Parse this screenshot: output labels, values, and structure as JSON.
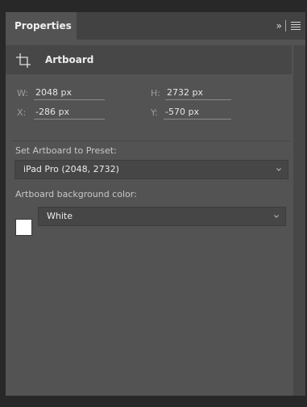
{
  "panel": {
    "tab_label": "Properties",
    "collapse_glyph": "»",
    "section_title": "Artboard"
  },
  "fields": {
    "w_label": "W:",
    "w_value": "2048 px",
    "h_label": "H:",
    "h_value": "2732 px",
    "x_label": "X:",
    "x_value": "-286 px",
    "y_label": "Y:",
    "y_value": "-570 px"
  },
  "preset": {
    "label": "Set Artboard to Preset:",
    "selected": "iPad Pro (2048, 2732)"
  },
  "background": {
    "label": "Artboard background color:",
    "selected": "White",
    "swatch_color": "#ffffff"
  },
  "icons": {
    "collapse": "double-chevron-right-icon",
    "menu": "hamburger-menu-icon",
    "artboard": "artboard-icon",
    "dropdown": "chevron-down-icon"
  },
  "colors": {
    "panel_bg": "#535353",
    "header_bg": "#474747",
    "tabbar_bg": "#424242"
  }
}
